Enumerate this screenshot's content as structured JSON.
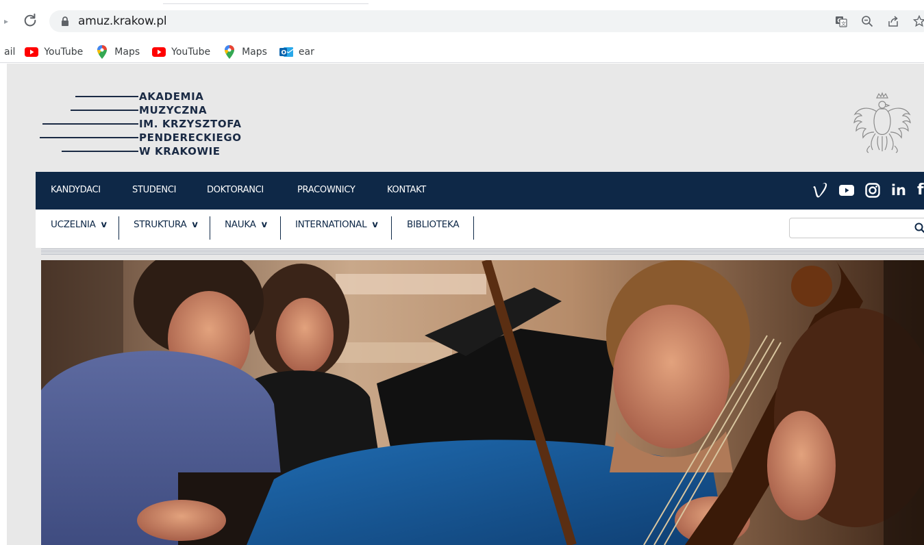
{
  "browser": {
    "url": "amuz.krakow.pl",
    "bookmarks": [
      {
        "label": "ail",
        "icon": "mail-icon"
      },
      {
        "label": "YouTube",
        "icon": "youtube-icon"
      },
      {
        "label": "Maps",
        "icon": "maps-pin-icon"
      },
      {
        "label": "YouTube",
        "icon": "youtube-icon"
      },
      {
        "label": "Maps",
        "icon": "maps-pin-icon"
      },
      {
        "label": "ear",
        "icon": "outlook-icon"
      }
    ]
  },
  "header": {
    "logo_lines": [
      "AKADEMIA",
      "MUZYCZNA",
      "IM. KRZYSZTOFA",
      "PENDERECKIEGO",
      "W KRAKOWIE"
    ]
  },
  "main_nav": {
    "items": [
      "KANDYDACI",
      "STUDENCI",
      "DOKTORANCI",
      "PRACOWNICY",
      "KONTAKT"
    ],
    "social": [
      "vimeo-icon",
      "youtube-icon",
      "instagram-icon",
      "linkedin-icon",
      "facebook-icon"
    ]
  },
  "sub_nav": {
    "items": [
      {
        "label": "UCZELNIA",
        "chevron": "v"
      },
      {
        "label": "STRUKTURA",
        "chevron": "v"
      },
      {
        "label": "NAUKA",
        "chevron": "v"
      },
      {
        "label": "INTERNATIONAL",
        "chevron": "v"
      },
      {
        "label": "BIBLIOTEKA",
        "chevron": ""
      }
    ],
    "search_placeholder": ""
  },
  "colors": {
    "navy": "#0e2847",
    "header_bg": "#e8e8e8"
  }
}
